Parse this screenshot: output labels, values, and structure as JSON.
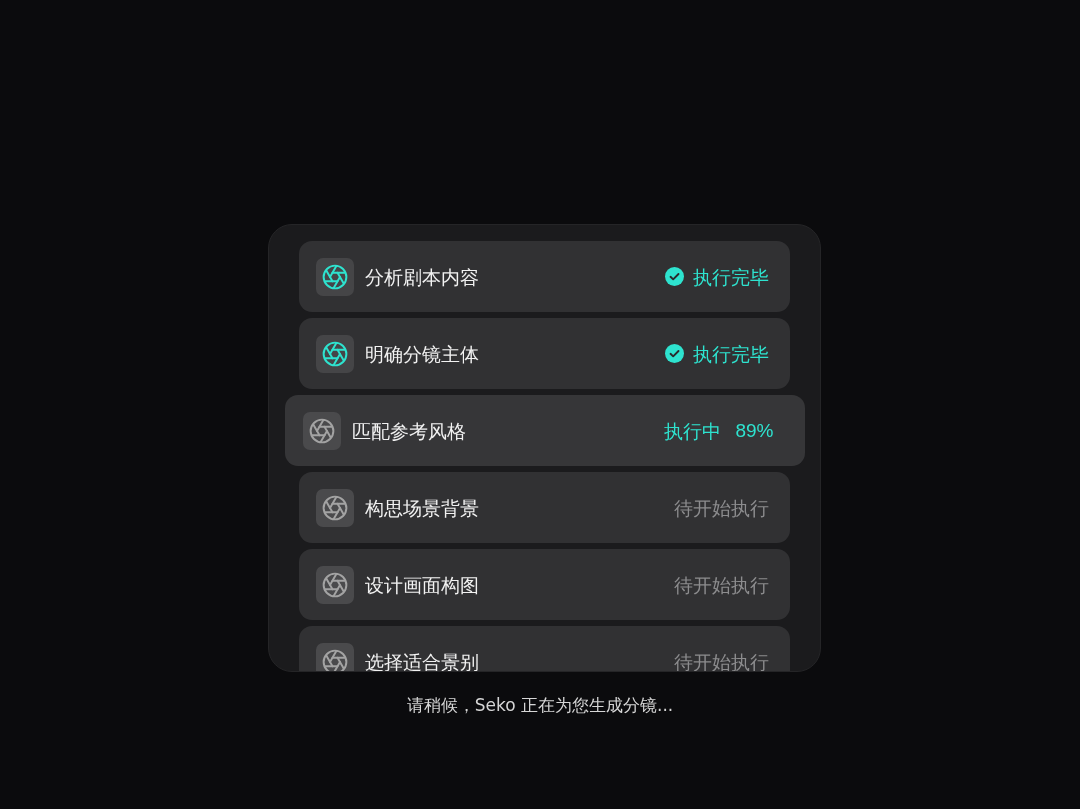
{
  "steps": [
    {
      "title": "分析剧本内容",
      "kind": "done",
      "status": "执行完毕"
    },
    {
      "title": "明确分镜主体",
      "kind": "done",
      "status": "执行完毕"
    },
    {
      "title": "匹配参考风格",
      "kind": "running",
      "status": "执行中",
      "progress": "89%"
    },
    {
      "title": "构思场景背景",
      "kind": "pending",
      "status": "待开始执行"
    },
    {
      "title": "设计画面构图",
      "kind": "pending",
      "status": "待开始执行"
    },
    {
      "title": "选择适合景别",
      "kind": "pending",
      "status": "待开始执行"
    }
  ],
  "caption": "请稍候，Seko 正在为您生成分镜..."
}
